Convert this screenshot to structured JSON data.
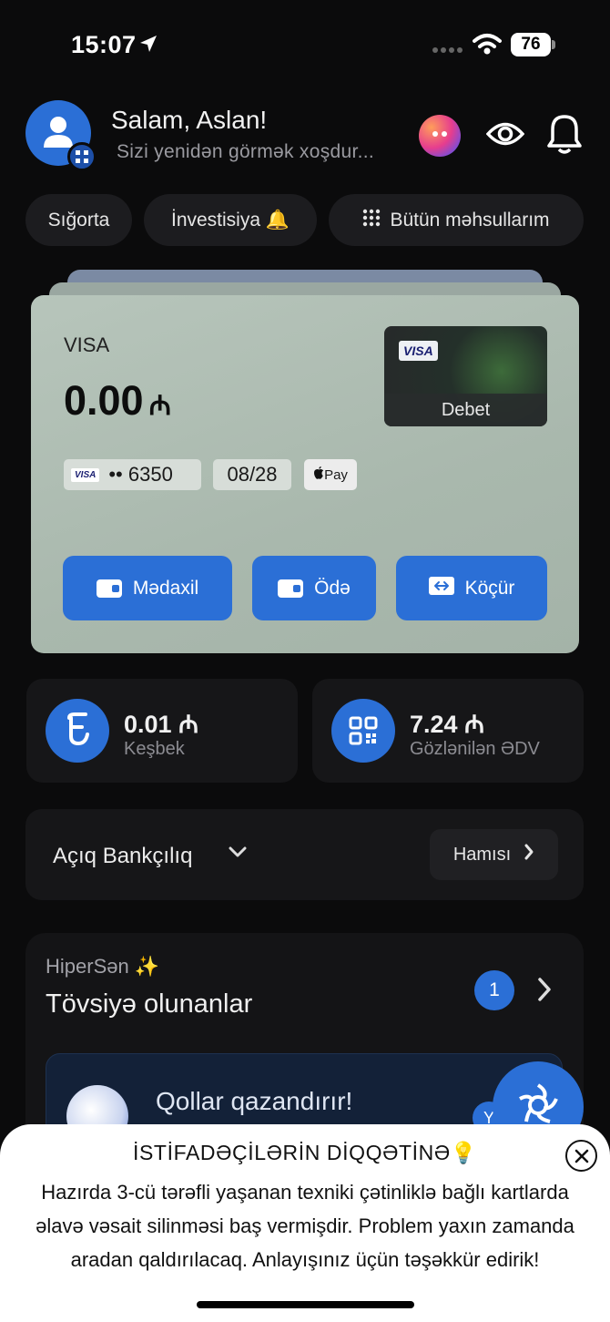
{
  "status_bar": {
    "time": "15:07",
    "battery": "76"
  },
  "header": {
    "greeting": "Salam, Aslan!",
    "subtitle": "Sizi yenidən görmək xoşdur..."
  },
  "chips": [
    {
      "label": "Sığorta"
    },
    {
      "label": "İnvestisiya 🔔"
    },
    {
      "label": "Bütün məhsullarım"
    }
  ],
  "card": {
    "brand": "VISA",
    "balance": "0.00",
    "currency": "₼",
    "number_mask": "•• 6350",
    "expiry": "08/28",
    "pay_badge": "Pay",
    "mini_card_brand": "VISA",
    "mini_card_type": "Debet",
    "actions": [
      {
        "label": "Mədaxil"
      },
      {
        "label": "Ödə"
      },
      {
        "label": "Köçür"
      }
    ]
  },
  "tiles": [
    {
      "value": "0.01",
      "currency": "₼",
      "label": "Keşbek"
    },
    {
      "value": "7.24",
      "currency": "₼",
      "label": "Gözlənilən ƏDV"
    }
  ],
  "open_banking": {
    "title": "Açıq Bankçılıq",
    "all_label": "Hamısı"
  },
  "recommendations": {
    "overline": "HiperSən ✨",
    "title": "Tövsiyə olunanlar",
    "count": "1",
    "promo_title": "Qollar qazandırır!",
    "promo_tag": "Y"
  },
  "notice": {
    "title": "İSTİFADƏÇİLƏRİN DİQQƏTİNƏ💡",
    "body": "Hazırda 3-cü tərəfli yaşanan texniki çətinliklə bağlı kartlarda əlavə vəsait silinməsi baş vermişdir. Problem yaxın zamanda aradan qaldırılacaq. Anlayışınız üçün təşəkkür edirik!"
  },
  "colors": {
    "accent": "#2b6fd6",
    "background": "#0b0b0c",
    "tile": "#161618",
    "card": "#b3c2b7"
  }
}
